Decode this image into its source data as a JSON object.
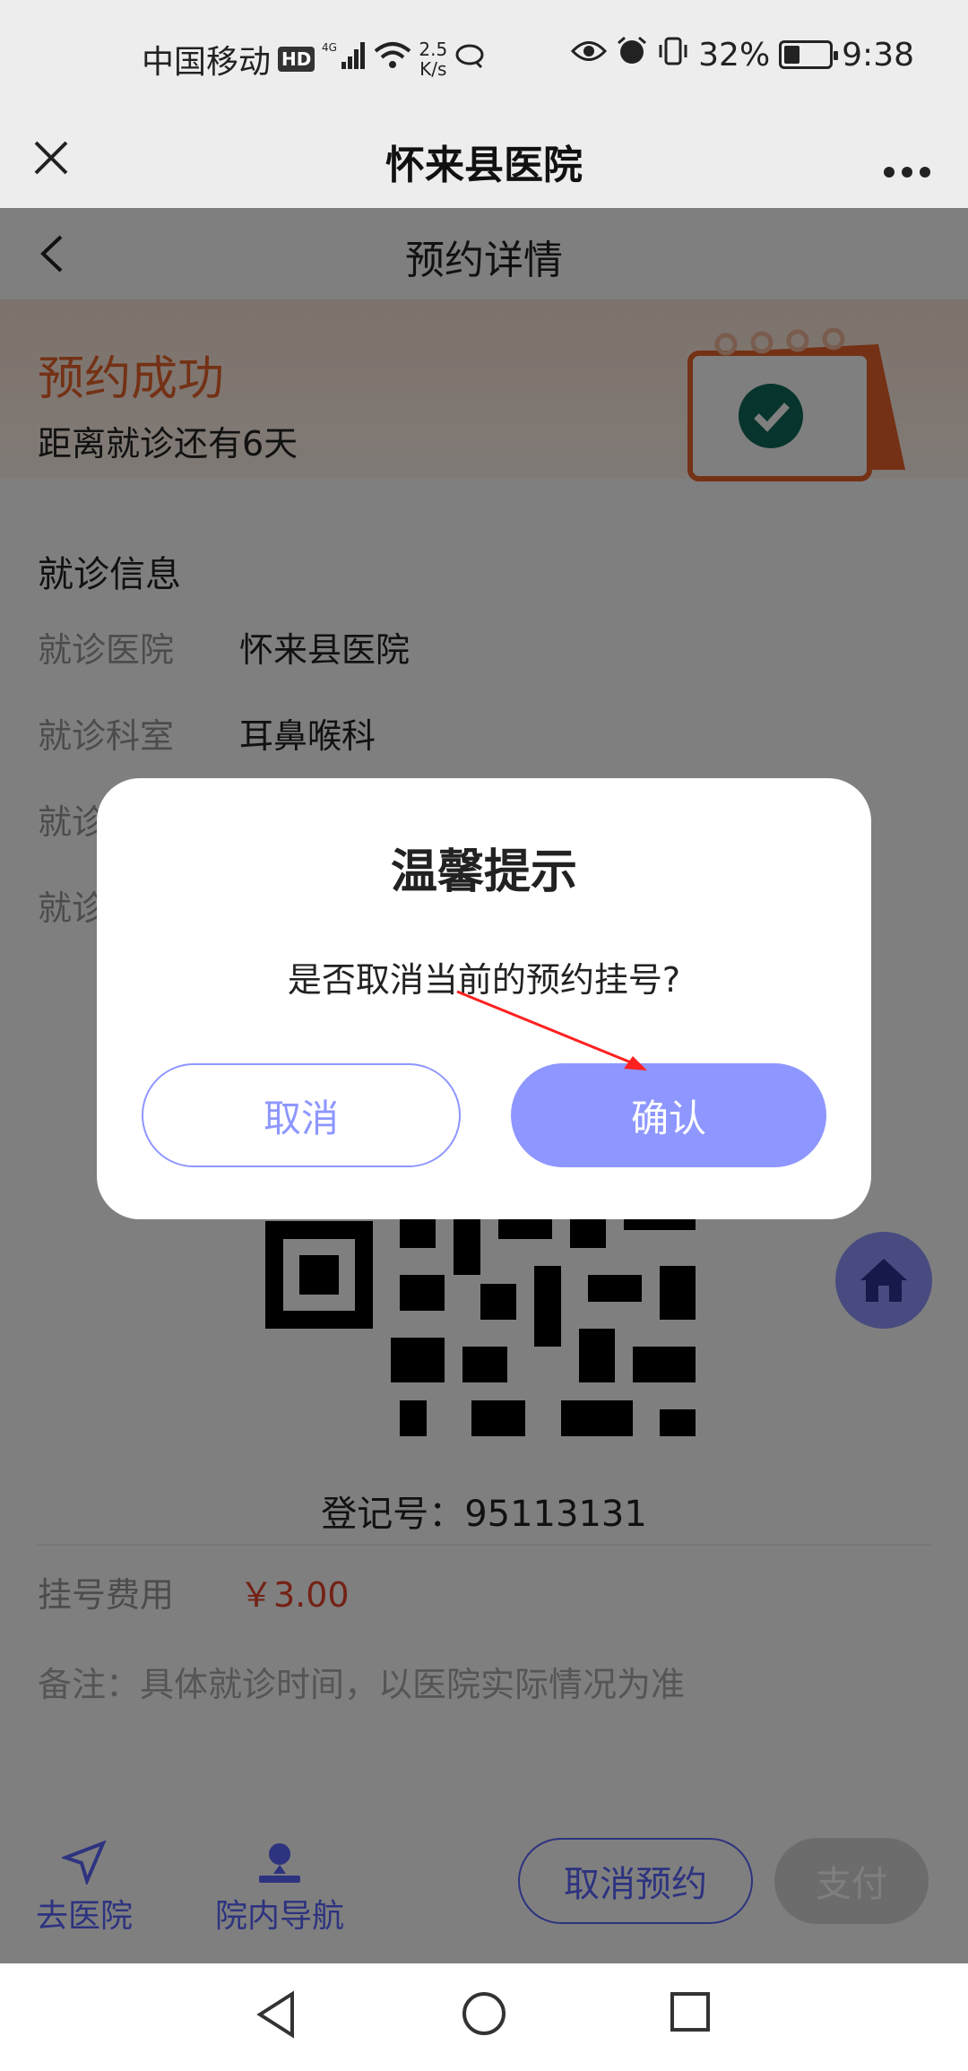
{
  "status_bar": {
    "carrier": "中国移动",
    "hd": "HD",
    "network": "4G",
    "speed_top": "2.5",
    "speed_bottom": "K/s",
    "battery_percent": "32%",
    "battery_level": 0.32,
    "time": "9:38"
  },
  "title_bar": {
    "title": "怀来县医院"
  },
  "page": {
    "title": "预约详情",
    "status": "预约成功",
    "countdown": "距离就诊还有6天",
    "section_title": "就诊信息",
    "info": [
      {
        "label": "就诊医院",
        "value": "怀来县医院"
      },
      {
        "label": "就诊科室",
        "value": "耳鼻喉科"
      },
      {
        "label": "就诊",
        "value": ""
      },
      {
        "label": "就诊",
        "value": ""
      }
    ],
    "registration": "登记号：95113131",
    "fee_label": "挂号费用",
    "fee_value": "￥3.00",
    "note": "备注：具体就诊时间，以医院实际情况为准"
  },
  "bottom_bar": {
    "go_hospital": "去医院",
    "navigation": "院内导航",
    "cancel_appointment": "取消预约",
    "pay": "支付"
  },
  "dialog": {
    "title": "温馨提示",
    "message": "是否取消当前的预约挂号?",
    "cancel": "取消",
    "confirm": "确认"
  },
  "colors": {
    "accent": "#8e97ff",
    "brand_blue": "#5b66ff",
    "success_orange": "#e8622a",
    "fee_red": "#e8432a",
    "annotation_arrow": "#ff2020"
  },
  "icons": [
    "close-icon",
    "more-icon",
    "back-icon",
    "calendar-check-icon",
    "qr-code",
    "home-icon",
    "send-icon",
    "location-pin-icon",
    "nav-back-icon",
    "nav-home-icon",
    "nav-recents-icon"
  ]
}
